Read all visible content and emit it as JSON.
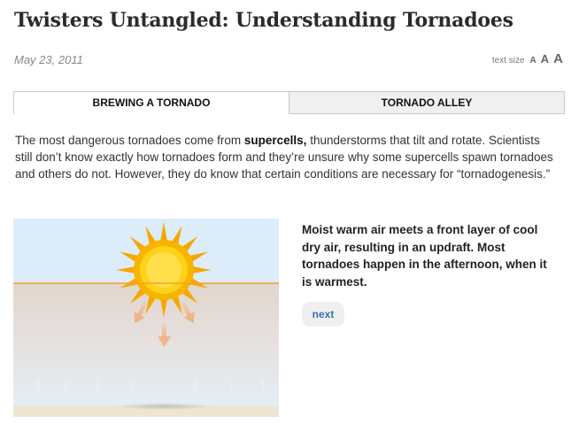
{
  "article": {
    "title": "Twisters Untangled: Understanding Tornadoes",
    "date": "May 23, 2011"
  },
  "text_size": {
    "label": "text size",
    "small": "A",
    "medium": "A",
    "large": "A"
  },
  "tabs": [
    {
      "label": "BREWING A TORNADO",
      "active": true
    },
    {
      "label": "TORNADO ALLEY",
      "active": false
    }
  ],
  "intro": {
    "part1": "The most dangerous tornadoes come from ",
    "bold": "supercells,",
    "part2": " thunderstorms that tilt and rotate. Scientists still don’t know exactly how tornadoes form and they’re unsure why some supercells spawn tornadoes and others do not.  However, they do know that certain conditions are necessary for “tornadogenesis.”"
  },
  "slide": {
    "caption": "Moist warm air meets a front layer of cool dry air, resulting in an updraft. Most tornadoes happen in the afternoon, when it is warmest.",
    "next_label": "next"
  },
  "colors": {
    "sky": "#dcecf8",
    "front_line": "#f0a030",
    "sun_ray": "#f5a800",
    "sun_core": "#ffd21a",
    "arrow": "#f0b48a",
    "ground": "#ece6d2",
    "link": "#3a6fb0"
  },
  "icons": {
    "sun": "sun-icon",
    "arrow": "down-arrow-icon"
  }
}
